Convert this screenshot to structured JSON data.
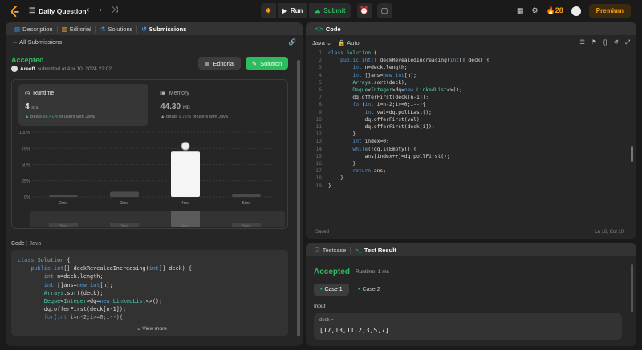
{
  "topbar": {
    "title": "Daily Question",
    "run_label": "Run",
    "submit_label": "Submit",
    "streak": "28",
    "premium_label": "Premium"
  },
  "left_tabs": [
    "Description",
    "Editorial",
    "Solutions",
    "Submissions"
  ],
  "back_label": "All Submissions",
  "result": {
    "status": "Accepted",
    "user": "Areeff",
    "submitted": "submitted at Apr 10, 2024 22:02",
    "editorial_btn": "Editorial",
    "solution_btn": "Solution"
  },
  "runtime": {
    "label": "Runtime",
    "value": "4",
    "unit": "ms",
    "beats_prefix": "Beats",
    "beats_value": "86.41%",
    "beats_suffix": "of users with Java"
  },
  "memory": {
    "label": "Memory",
    "value": "44.30",
    "unit": "MB",
    "beats_prefix": "Beats",
    "beats_value": "9.71%",
    "beats_suffix": "of users with Java"
  },
  "chart_data": {
    "type": "bar",
    "categories": [
      "2ms",
      "3ms",
      "4ms",
      "5ms"
    ],
    "values": [
      2,
      8,
      70,
      5
    ],
    "highlight": "4ms",
    "ylim": [
      0,
      100
    ],
    "yticks": [
      "100%",
      "75%",
      "50%",
      "25%",
      "0%"
    ]
  },
  "code_section": {
    "label": "Code",
    "lang": "Java",
    "view_more": "View more"
  },
  "editor": {
    "header": "Code",
    "lang": "Java",
    "mode": "Auto",
    "saved": "Saved",
    "cursor": "Ln 16, Col 10",
    "line_numbers": [
      "1",
      "2",
      "3",
      "4",
      "5",
      "6",
      "7",
      "8",
      "9",
      "10",
      "11",
      "12",
      "13",
      "14",
      "15",
      "16",
      "17",
      "18"
    ]
  },
  "code_lines": [
    "class Solution {",
    "    public int[] deckRevealedIncreasing(int[] deck) {",
    "        int n=deck.length;",
    "        int []ans=new int[n];",
    "        Arrays.sort(deck);",
    "        Deque<Integer>dq=new LinkedList<>();",
    "        dq.offerFirst(deck[n-1]);",
    "        for(int i=n-2;i>=0;i--){",
    "            int val=dq.pollLast();",
    "            dq.offerFirst(val);",
    "            dq.offerFirst(deck[i]);",
    "        }",
    "        int index=0;",
    "        while(!dq.isEmpty()){",
    "            ans[index++]=dq.pollFirst();",
    "        }",
    "        return ans;",
    "    }",
    "}"
  ],
  "bottom_tabs": [
    "Testcase",
    "Test Result"
  ],
  "test_result": {
    "status": "Accepted",
    "runtime": "Runtime: 1 ms",
    "cases": [
      "Case 1",
      "Case 2"
    ],
    "input_label": "Input",
    "var_name": "deck =",
    "var_value": "[17,13,11,2,3,5,7]"
  }
}
